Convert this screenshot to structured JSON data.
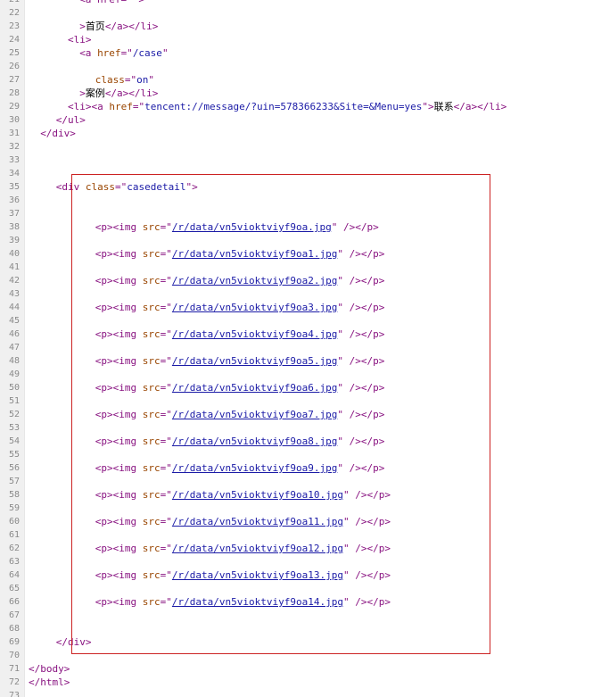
{
  "accent": {
    "tag": "#881280",
    "attr": "#994500",
    "value": "#1a1aa6",
    "highlight_border": "#cc2222"
  },
  "lines": [
    {
      "n": "21",
      "indent": 13,
      "tokens": [
        {
          "k": "tag",
          "t": "<a href=\""
        },
        {
          "k": "tag",
          "t": "\">"
        }
      ]
    },
    {
      "n": "22",
      "indent": 0,
      "tokens": []
    },
    {
      "n": "23",
      "indent": 13,
      "tokens": [
        {
          "k": "tag",
          "t": ">"
        },
        {
          "k": "text",
          "t": "首页"
        },
        {
          "k": "tag",
          "t": "</a></li>"
        }
      ]
    },
    {
      "n": "24",
      "indent": 10,
      "tokens": [
        {
          "k": "tag",
          "t": "<li>"
        }
      ]
    },
    {
      "n": "25",
      "indent": 13,
      "tokens": [
        {
          "k": "tag",
          "t": "<a "
        },
        {
          "k": "attr",
          "t": "href"
        },
        {
          "k": "tag",
          "t": "=\""
        },
        {
          "k": "val",
          "t": "/case"
        },
        {
          "k": "tag",
          "t": "\""
        }
      ]
    },
    {
      "n": "26",
      "indent": 0,
      "tokens": []
    },
    {
      "n": "27",
      "indent": 17,
      "tokens": [
        {
          "k": "attr",
          "t": "class"
        },
        {
          "k": "tag",
          "t": "=\""
        },
        {
          "k": "val",
          "t": "on"
        },
        {
          "k": "tag",
          "t": "\""
        }
      ]
    },
    {
      "n": "28",
      "indent": 13,
      "tokens": [
        {
          "k": "tag",
          "t": ">"
        },
        {
          "k": "text",
          "t": "案例"
        },
        {
          "k": "tag",
          "t": "</a></li>"
        }
      ]
    },
    {
      "n": "29",
      "indent": 10,
      "tokens": [
        {
          "k": "tag",
          "t": "<li><a "
        },
        {
          "k": "attr",
          "t": "href"
        },
        {
          "k": "tag",
          "t": "=\""
        },
        {
          "k": "val",
          "t": "tencent://message/?uin=578366233&Site=&Menu=yes"
        },
        {
          "k": "tag",
          "t": "\">"
        },
        {
          "k": "text",
          "t": "联系"
        },
        {
          "k": "tag",
          "t": "</a></li>"
        }
      ]
    },
    {
      "n": "30",
      "indent": 7,
      "tokens": [
        {
          "k": "tag",
          "t": "</ul>"
        }
      ]
    },
    {
      "n": "31",
      "indent": 3,
      "tokens": [
        {
          "k": "tag",
          "t": "</div>"
        }
      ]
    },
    {
      "n": "32",
      "indent": 0,
      "tokens": []
    },
    {
      "n": "33",
      "indent": 0,
      "tokens": []
    },
    {
      "n": "34",
      "indent": 0,
      "tokens": []
    },
    {
      "n": "35",
      "indent": 7,
      "tokens": [
        {
          "k": "tag",
          "t": "<div "
        },
        {
          "k": "attr",
          "t": "class"
        },
        {
          "k": "tag",
          "t": "=\""
        },
        {
          "k": "val",
          "t": "casedetail"
        },
        {
          "k": "tag",
          "t": "\">"
        }
      ]
    },
    {
      "n": "36",
      "indent": 0,
      "tokens": []
    },
    {
      "n": "37",
      "indent": 0,
      "tokens": []
    },
    {
      "n": "38",
      "indent": 17,
      "tokens": [
        {
          "k": "tag",
          "t": "<p><img "
        },
        {
          "k": "attr",
          "t": "src"
        },
        {
          "k": "tag",
          "t": "=\""
        },
        {
          "k": "link",
          "t": "/r/data/vn5vioktviyf9oa.jpg"
        },
        {
          "k": "tag",
          "t": "\" /></p>"
        }
      ]
    },
    {
      "n": "39",
      "indent": 0,
      "tokens": []
    },
    {
      "n": "40",
      "indent": 17,
      "tokens": [
        {
          "k": "tag",
          "t": "<p><img "
        },
        {
          "k": "attr",
          "t": "src"
        },
        {
          "k": "tag",
          "t": "=\""
        },
        {
          "k": "link",
          "t": "/r/data/vn5vioktviyf9oa1.jpg"
        },
        {
          "k": "tag",
          "t": "\" /></p>"
        }
      ]
    },
    {
      "n": "41",
      "indent": 0,
      "tokens": []
    },
    {
      "n": "42",
      "indent": 17,
      "tokens": [
        {
          "k": "tag",
          "t": "<p><img "
        },
        {
          "k": "attr",
          "t": "src"
        },
        {
          "k": "tag",
          "t": "=\""
        },
        {
          "k": "link",
          "t": "/r/data/vn5vioktviyf9oa2.jpg"
        },
        {
          "k": "tag",
          "t": "\" /></p>"
        }
      ]
    },
    {
      "n": "43",
      "indent": 0,
      "tokens": []
    },
    {
      "n": "44",
      "indent": 17,
      "tokens": [
        {
          "k": "tag",
          "t": "<p><img "
        },
        {
          "k": "attr",
          "t": "src"
        },
        {
          "k": "tag",
          "t": "=\""
        },
        {
          "k": "link",
          "t": "/r/data/vn5vioktviyf9oa3.jpg"
        },
        {
          "k": "tag",
          "t": "\" /></p>"
        }
      ]
    },
    {
      "n": "45",
      "indent": 0,
      "tokens": []
    },
    {
      "n": "46",
      "indent": 17,
      "tokens": [
        {
          "k": "tag",
          "t": "<p><img "
        },
        {
          "k": "attr",
          "t": "src"
        },
        {
          "k": "tag",
          "t": "=\""
        },
        {
          "k": "link",
          "t": "/r/data/vn5vioktviyf9oa4.jpg"
        },
        {
          "k": "tag",
          "t": "\" /></p>"
        }
      ]
    },
    {
      "n": "47",
      "indent": 0,
      "tokens": []
    },
    {
      "n": "48",
      "indent": 17,
      "tokens": [
        {
          "k": "tag",
          "t": "<p><img "
        },
        {
          "k": "attr",
          "t": "src"
        },
        {
          "k": "tag",
          "t": "=\""
        },
        {
          "k": "link",
          "t": "/r/data/vn5vioktviyf9oa5.jpg"
        },
        {
          "k": "tag",
          "t": "\" /></p>"
        }
      ]
    },
    {
      "n": "49",
      "indent": 0,
      "tokens": []
    },
    {
      "n": "50",
      "indent": 17,
      "tokens": [
        {
          "k": "tag",
          "t": "<p><img "
        },
        {
          "k": "attr",
          "t": "src"
        },
        {
          "k": "tag",
          "t": "=\""
        },
        {
          "k": "link",
          "t": "/r/data/vn5vioktviyf9oa6.jpg"
        },
        {
          "k": "tag",
          "t": "\" /></p>"
        }
      ]
    },
    {
      "n": "51",
      "indent": 0,
      "tokens": []
    },
    {
      "n": "52",
      "indent": 17,
      "tokens": [
        {
          "k": "tag",
          "t": "<p><img "
        },
        {
          "k": "attr",
          "t": "src"
        },
        {
          "k": "tag",
          "t": "=\""
        },
        {
          "k": "link",
          "t": "/r/data/vn5vioktviyf9oa7.jpg"
        },
        {
          "k": "tag",
          "t": "\" /></p>"
        }
      ]
    },
    {
      "n": "53",
      "indent": 0,
      "tokens": []
    },
    {
      "n": "54",
      "indent": 17,
      "tokens": [
        {
          "k": "tag",
          "t": "<p><img "
        },
        {
          "k": "attr",
          "t": "src"
        },
        {
          "k": "tag",
          "t": "=\""
        },
        {
          "k": "link",
          "t": "/r/data/vn5vioktviyf9oa8.jpg"
        },
        {
          "k": "tag",
          "t": "\" /></p>"
        }
      ]
    },
    {
      "n": "55",
      "indent": 0,
      "tokens": []
    },
    {
      "n": "56",
      "indent": 17,
      "tokens": [
        {
          "k": "tag",
          "t": "<p><img "
        },
        {
          "k": "attr",
          "t": "src"
        },
        {
          "k": "tag",
          "t": "=\""
        },
        {
          "k": "link",
          "t": "/r/data/vn5vioktviyf9oa9.jpg"
        },
        {
          "k": "tag",
          "t": "\" /></p>"
        }
      ]
    },
    {
      "n": "57",
      "indent": 0,
      "tokens": []
    },
    {
      "n": "58",
      "indent": 17,
      "tokens": [
        {
          "k": "tag",
          "t": "<p><img "
        },
        {
          "k": "attr",
          "t": "src"
        },
        {
          "k": "tag",
          "t": "=\""
        },
        {
          "k": "link",
          "t": "/r/data/vn5vioktviyf9oa10.jpg"
        },
        {
          "k": "tag",
          "t": "\" /></p>"
        }
      ]
    },
    {
      "n": "59",
      "indent": 0,
      "tokens": []
    },
    {
      "n": "60",
      "indent": 17,
      "tokens": [
        {
          "k": "tag",
          "t": "<p><img "
        },
        {
          "k": "attr",
          "t": "src"
        },
        {
          "k": "tag",
          "t": "=\""
        },
        {
          "k": "link",
          "t": "/r/data/vn5vioktviyf9oa11.jpg"
        },
        {
          "k": "tag",
          "t": "\" /></p>"
        }
      ]
    },
    {
      "n": "61",
      "indent": 0,
      "tokens": []
    },
    {
      "n": "62",
      "indent": 17,
      "tokens": [
        {
          "k": "tag",
          "t": "<p><img "
        },
        {
          "k": "attr",
          "t": "src"
        },
        {
          "k": "tag",
          "t": "=\""
        },
        {
          "k": "link",
          "t": "/r/data/vn5vioktviyf9oa12.jpg"
        },
        {
          "k": "tag",
          "t": "\" /></p>"
        }
      ]
    },
    {
      "n": "63",
      "indent": 0,
      "tokens": []
    },
    {
      "n": "64",
      "indent": 17,
      "tokens": [
        {
          "k": "tag",
          "t": "<p><img "
        },
        {
          "k": "attr",
          "t": "src"
        },
        {
          "k": "tag",
          "t": "=\""
        },
        {
          "k": "link",
          "t": "/r/data/vn5vioktviyf9oa13.jpg"
        },
        {
          "k": "tag",
          "t": "\" /></p>"
        }
      ]
    },
    {
      "n": "65",
      "indent": 0,
      "tokens": []
    },
    {
      "n": "66",
      "indent": 17,
      "tokens": [
        {
          "k": "tag",
          "t": "<p><img "
        },
        {
          "k": "attr",
          "t": "src"
        },
        {
          "k": "tag",
          "t": "=\""
        },
        {
          "k": "link",
          "t": "/r/data/vn5vioktviyf9oa14.jpg"
        },
        {
          "k": "tag",
          "t": "\" /></p>"
        }
      ]
    },
    {
      "n": "67",
      "indent": 0,
      "tokens": []
    },
    {
      "n": "68",
      "indent": 0,
      "tokens": []
    },
    {
      "n": "69",
      "indent": 7,
      "tokens": [
        {
          "k": "tag",
          "t": "</div>"
        }
      ]
    },
    {
      "n": "70",
      "indent": 0,
      "tokens": []
    },
    {
      "n": "71",
      "indent": 0,
      "tokens": [
        {
          "k": "tag",
          "t": "</body>"
        }
      ]
    },
    {
      "n": "72",
      "indent": 0,
      "tokens": [
        {
          "k": "tag",
          "t": "</html>"
        }
      ]
    },
    {
      "n": "73",
      "indent": 0,
      "tokens": []
    }
  ]
}
